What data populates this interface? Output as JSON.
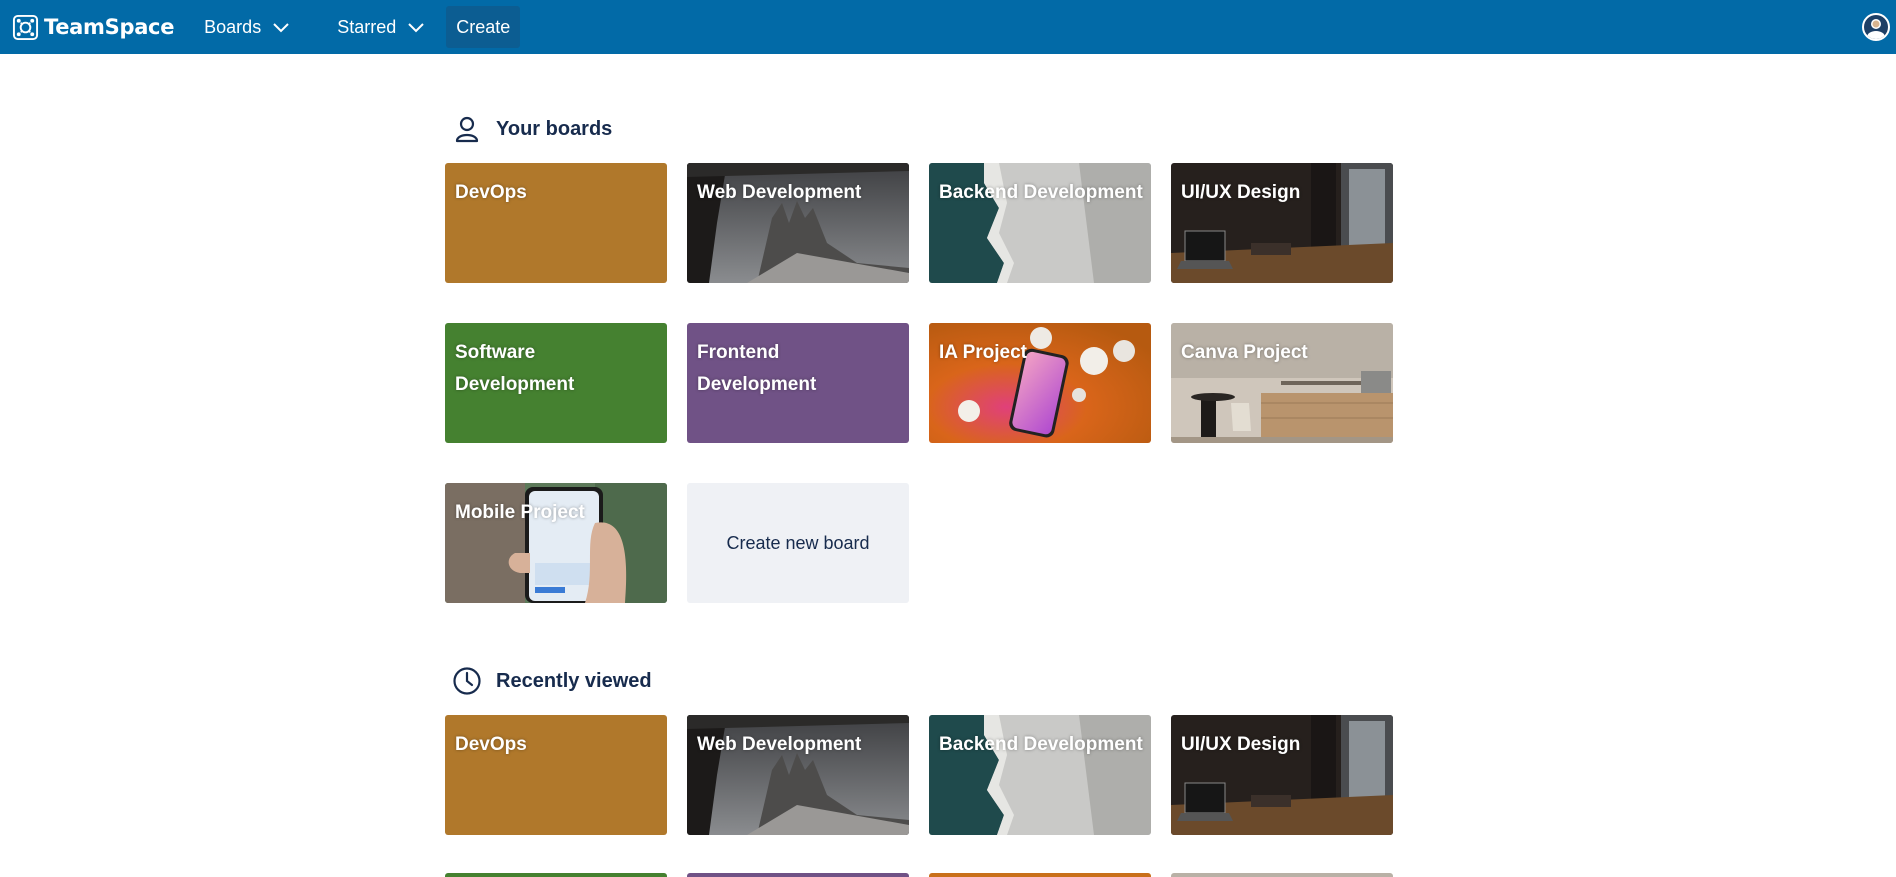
{
  "header": {
    "brand": "TeamSpace",
    "nav": {
      "boards": "Boards",
      "starred": "Starred",
      "create": "Create"
    },
    "colors": {
      "bar": "#026aa7",
      "create_bg": "#0c5d92"
    }
  },
  "sections": {
    "your_boards": {
      "title": "Your boards",
      "icon": "user-icon",
      "boards": [
        {
          "label": "DevOps",
          "bg": "solid-ochre"
        },
        {
          "label": "Web Development",
          "bg": "photo-mountains"
        },
        {
          "label": "Backend Development",
          "bg": "photo-aerial-shore"
        },
        {
          "label": "UI/UX Design",
          "bg": "photo-dark-interior"
        },
        {
          "label": "Software Development",
          "bg": "solid-green"
        },
        {
          "label": "Frontend Development",
          "bg": "solid-purple"
        },
        {
          "label": "IA Project",
          "bg": "photo-phone-bulbs"
        },
        {
          "label": "Canva Project",
          "bg": "photo-kitchen"
        },
        {
          "label": "Mobile Project",
          "bg": "photo-phone-hand"
        }
      ],
      "create_label": "Create new board"
    },
    "recently_viewed": {
      "title": "Recently viewed",
      "icon": "clock-icon",
      "boards": [
        {
          "label": "DevOps",
          "bg": "solid-ochre"
        },
        {
          "label": "Web Development",
          "bg": "photo-mountains"
        },
        {
          "label": "Backend Development",
          "bg": "photo-aerial-shore"
        },
        {
          "label": "UI/UX Design",
          "bg": "photo-dark-interior"
        }
      ]
    }
  },
  "colors": {
    "ochre": "#b0782b",
    "green": "#458130",
    "purple": "#705286",
    "create_tile": "#eff1f5",
    "text": "#172b4d"
  }
}
